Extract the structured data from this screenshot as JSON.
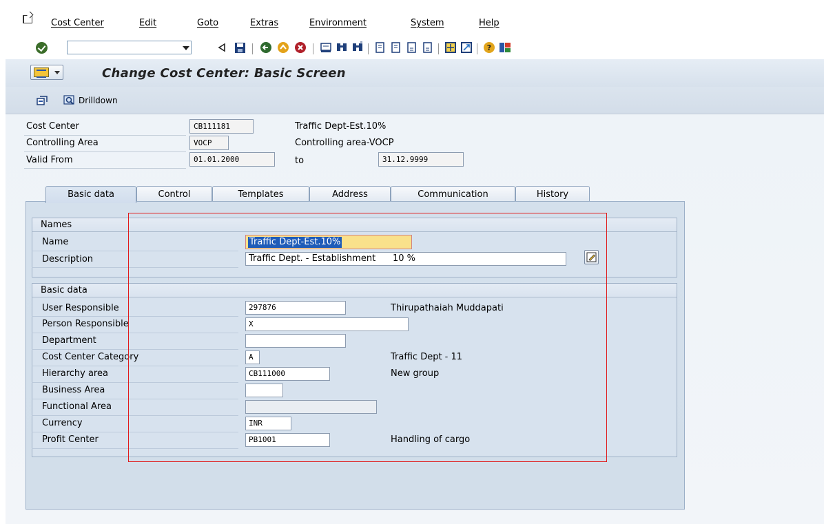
{
  "menu": {
    "items": [
      "Cost Center",
      "Edit",
      "Goto",
      "Extras",
      "Environment",
      "System",
      "Help"
    ]
  },
  "toolbar": {
    "command_value": "",
    "icons": [
      "enter-icon",
      "back-icon",
      "save-icon",
      "back-nav-icon",
      "exit-icon",
      "cancel-icon",
      "print-icon",
      "find-icon",
      "find-next-icon",
      "first-page-icon",
      "previous-page-icon",
      "next-page-icon",
      "last-page-icon",
      "new-session-icon",
      "shortcut-icon",
      "help-icon",
      "customize-layout-icon"
    ]
  },
  "title": {
    "text": "Change Cost Center: Basic Screen"
  },
  "app_toolbar": {
    "drilldown_label": "Drilldown"
  },
  "header": {
    "cost_center_label": "Cost Center",
    "cost_center_value": "CB111181",
    "cost_center_desc": "Traffic Dept-Est.10%",
    "controlling_area_label": "Controlling Area",
    "controlling_area_value": "VOCP",
    "controlling_area_desc": "Controlling area-VOCP",
    "valid_from_label": "Valid From",
    "valid_from_value": "01.01.2000",
    "to_label": "to",
    "valid_to_value": "31.12.9999"
  },
  "tabs": [
    {
      "label": "Basic data",
      "active": true
    },
    {
      "label": "Control",
      "active": false
    },
    {
      "label": "Templates",
      "active": false
    },
    {
      "label": "Address",
      "active": false
    },
    {
      "label": "Communication",
      "active": false
    },
    {
      "label": "History",
      "active": false
    }
  ],
  "names_group": {
    "title": "Names",
    "name_label": "Name",
    "name_value": "Traffic Dept-Est.10%",
    "description_label": "Description",
    "description_value": "Traffic Dept. - Establishment      10 %"
  },
  "basic_group": {
    "title": "Basic data",
    "user_responsible_label": "User Responsible",
    "user_responsible_value": "297876",
    "user_responsible_desc": "Thirupathaiah Muddapati",
    "person_responsible_label": "Person Responsible",
    "person_responsible_value": "X",
    "department_label": "Department",
    "department_value": "",
    "category_label": "Cost Center Category",
    "category_value": "A",
    "category_desc": "Traffic Dept - 11",
    "hierarchy_label": "Hierarchy area",
    "hierarchy_value": "CB111000",
    "hierarchy_desc": "New group",
    "business_area_label": "Business Area",
    "business_area_value": "",
    "functional_area_label": "Functional Area",
    "functional_area_value": "",
    "currency_label": "Currency",
    "currency_value": "INR",
    "profit_center_label": "Profit Center",
    "profit_center_value": "PB1001",
    "profit_center_desc": "Handling of cargo"
  },
  "colors": {
    "highlight_box": "#e01b1b",
    "selection": "#1f5cb8",
    "name_field_bg": "#f9e18b"
  }
}
